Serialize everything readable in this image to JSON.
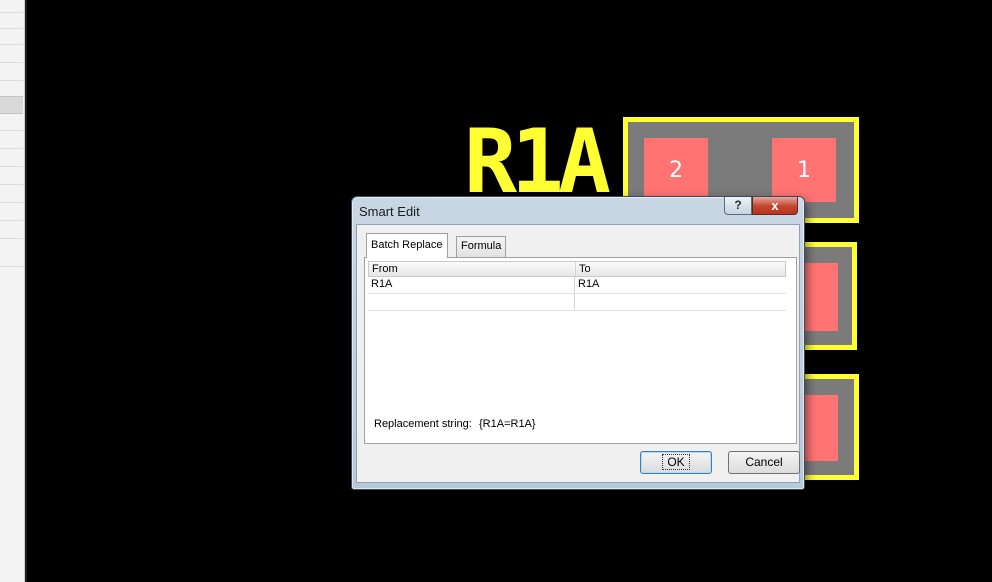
{
  "dialog": {
    "title": "Smart Edit",
    "help_label": "?",
    "close_label": "x",
    "tabs": [
      {
        "label": "Batch Replace",
        "active": true
      },
      {
        "label": "Formula",
        "active": false
      }
    ],
    "table": {
      "headers": [
        "From",
        "To"
      ],
      "rows": [
        [
          "R1A",
          "R1A"
        ],
        [
          "",
          ""
        ]
      ]
    },
    "replacement_label": "Replacement string:",
    "replacement_value": "{R1A=R1A}",
    "ok_label": "OK",
    "cancel_label": "Cancel"
  },
  "pcb": {
    "designator": "R1A",
    "pad_labels": [
      "2",
      "1"
    ],
    "colors": {
      "background": "#000000",
      "silkscreen": "#ffff33",
      "pad": "#ff7373",
      "body": "#7b7b7b"
    }
  }
}
